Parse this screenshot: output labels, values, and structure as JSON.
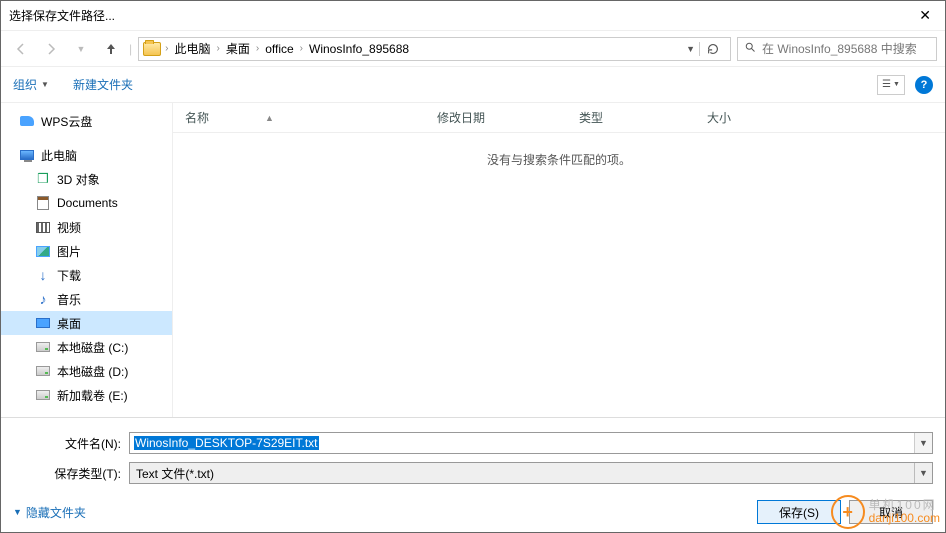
{
  "title": "选择保存文件路径...",
  "breadcrumbs": [
    "此电脑",
    "桌面",
    "office",
    "WinosInfo_895688"
  ],
  "search_placeholder": "在 WinosInfo_895688 中搜索",
  "toolbar": {
    "organize": "组织",
    "new_folder": "新建文件夹"
  },
  "sidebar": {
    "wps": "WPS云盘",
    "pc": "此电脑",
    "children": [
      {
        "label": "3D 对象"
      },
      {
        "label": "Documents"
      },
      {
        "label": "视频"
      },
      {
        "label": "图片"
      },
      {
        "label": "下载"
      },
      {
        "label": "音乐"
      },
      {
        "label": "桌面"
      },
      {
        "label": "本地磁盘 (C:)"
      },
      {
        "label": "本地磁盘 (D:)"
      },
      {
        "label": "新加载卷 (E:)"
      }
    ]
  },
  "columns": {
    "name": "名称",
    "date": "修改日期",
    "type": "类型",
    "size": "大小"
  },
  "empty_text": "没有与搜索条件匹配的项。",
  "fields": {
    "filename_label": "文件名(N):",
    "filename_value": "WinosInfo_DESKTOP-7S29EIT.txt",
    "filetype_label": "保存类型(T):",
    "filetype_value": "Text 文件(*.txt)"
  },
  "footer": {
    "hide_folders": "隐藏文件夹",
    "save": "保存(S)",
    "cancel": "取消"
  },
  "watermark": {
    "cn": "单机100网",
    "url": "danji100.com"
  }
}
